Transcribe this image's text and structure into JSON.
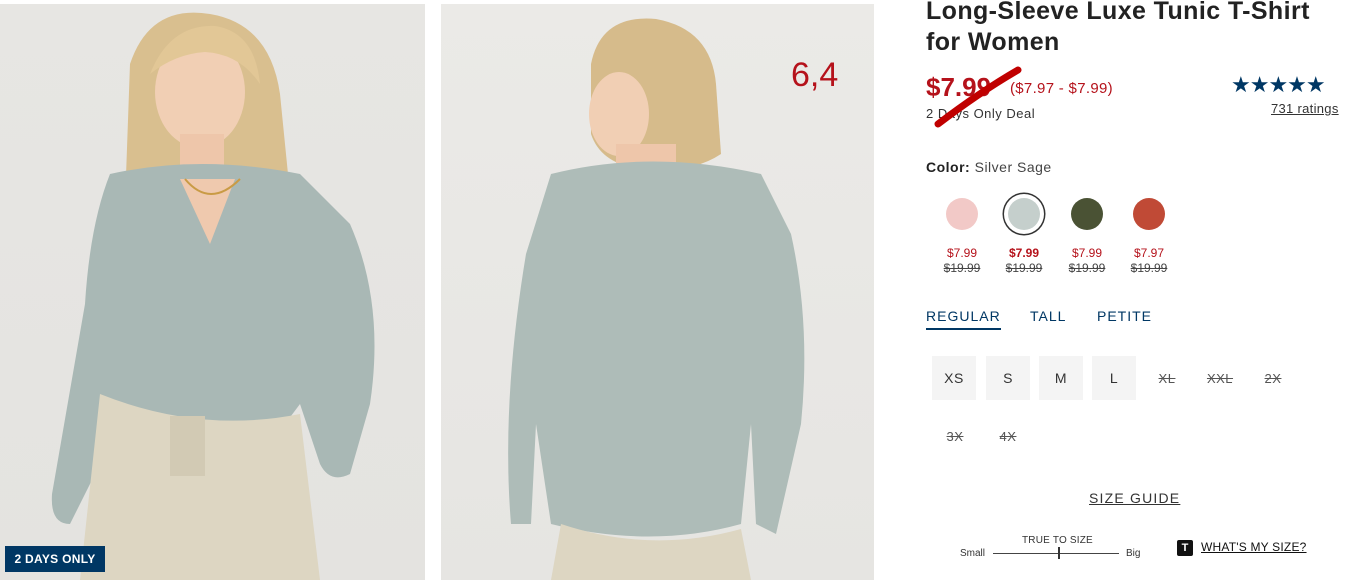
{
  "images": {
    "front_alt": "",
    "badge": "2 DAYS ONLY",
    "overlay_number": "6,4"
  },
  "product": {
    "title": "Long-Sleeve Luxe Tunic T-Shirt for Women",
    "price_now": "$7.99",
    "price_range": "($7.97 - $7.99)",
    "deal_label": "2 Days Only Deal",
    "stars_glyph": "★★★★★",
    "ratings_link": "731 ratings",
    "rating_value": 4.5,
    "color_label": "Color:",
    "color_value": "Silver Sage"
  },
  "swatches": [
    {
      "color": "#f2c9c7",
      "price": "$7.99",
      "orig": "$19.99",
      "selected": false
    },
    {
      "color": "#c5cfcc",
      "price": "$7.99",
      "orig": "$19.99",
      "selected": true
    },
    {
      "color": "#4a5234",
      "price": "$7.99",
      "orig": "$19.99",
      "selected": false
    },
    {
      "color": "#c04a36",
      "price": "$7.97",
      "orig": "$19.99",
      "selected": false
    }
  ],
  "fits": [
    "REGULAR",
    "TALL",
    "PETITE"
  ],
  "sizes_available": [
    "XS",
    "S",
    "M",
    "L"
  ],
  "sizes_unavailable": [
    "XL",
    "XXL",
    "2X",
    "3X",
    "4X"
  ],
  "size_guide": "SIZE GUIDE",
  "true_to_size": {
    "label": "TRUE TO SIZE",
    "small": "Small",
    "big": "Big"
  },
  "whats_my_size": {
    "icon": "T",
    "label": "WHAT'S MY SIZE?"
  },
  "colors": {
    "sale_red": "#b5121b",
    "navy": "#003764"
  }
}
